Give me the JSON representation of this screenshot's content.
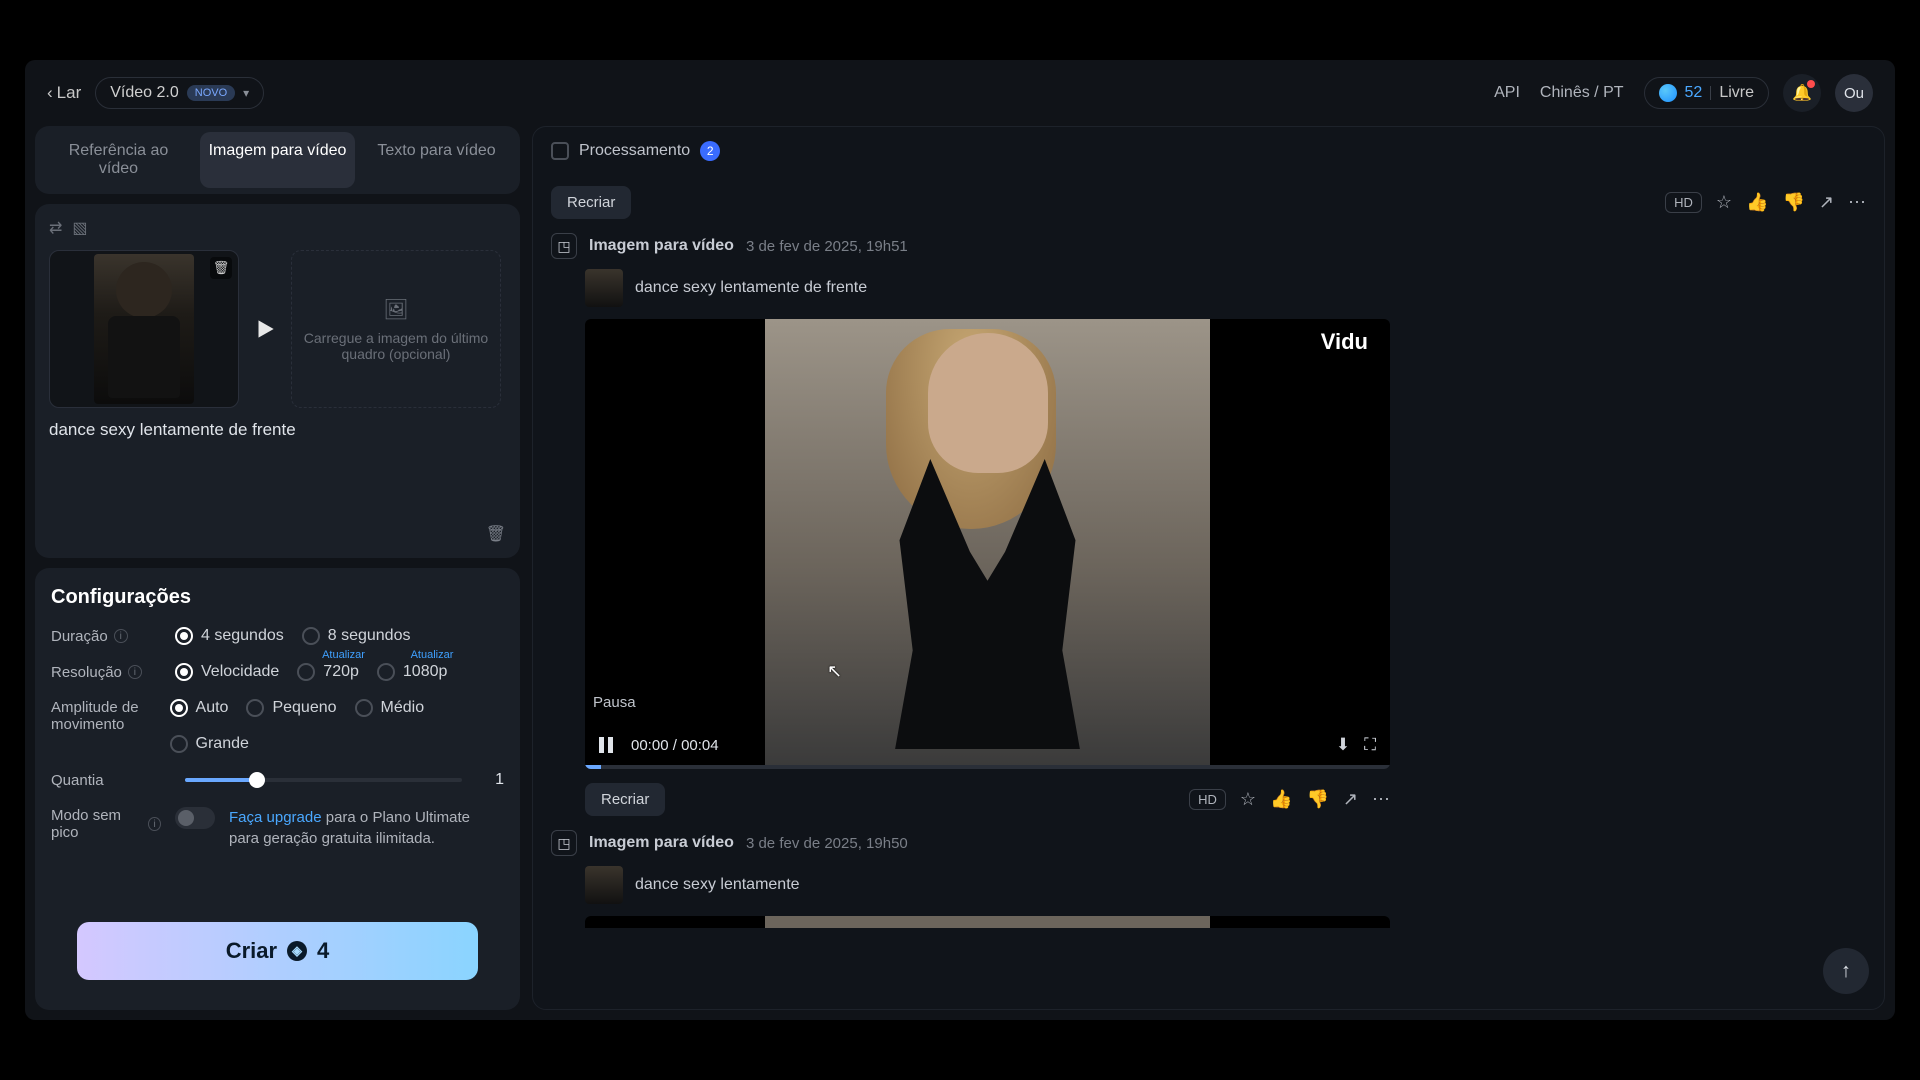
{
  "header": {
    "back_label": "Lar",
    "version_label": "Vídeo 2.0",
    "novo_badge": "NOVO",
    "api_label": "API",
    "language_label": "Chinês / PT",
    "credits": "52",
    "plan": "Livre",
    "avatar_initials": "Ou"
  },
  "tabs": {
    "ref": "Referência ao vídeo",
    "img": "Imagem para vídeo",
    "txt": "Texto para vídeo"
  },
  "upload": {
    "drop_text": "Carregue a imagem do último quadro (opcional)",
    "prompt": "dance sexy lentamente de frente"
  },
  "settings": {
    "title": "Configurações",
    "duration_label": "Duração",
    "duration_4s": "4 segundos",
    "duration_8s": "8 segundos",
    "resolution_label": "Resolução",
    "res_speed": "Velocidade",
    "res_720": "720p",
    "res_1080": "1080p",
    "atualizar": "Atualizar",
    "motion_label": "Amplitude de movimento",
    "motion_auto": "Auto",
    "motion_small": "Pequeno",
    "motion_medium": "Médio",
    "motion_large": "Grande",
    "quantity_label": "Quantia",
    "quantity_value": "1",
    "offpeak_label": "Modo sem pico",
    "upgrade_link": "Faça upgrade",
    "upgrade_rest": " para o Plano Ultimate para geração gratuita ilimitada."
  },
  "create": {
    "label": "Criar",
    "cost": "4"
  },
  "main": {
    "processing_label": "Processamento",
    "processing_count": "2",
    "recriar": "Recriar",
    "hd": "HD",
    "gen_type": "Imagem para vídeo",
    "gen1_time": "3 de fev de 2025, 19h51",
    "gen1_prompt": "dance sexy lentamente de frente",
    "gen2_time": "3 de fev de 2025, 19h50",
    "gen2_prompt": "dance sexy lentamente",
    "watermark": "Vidu",
    "pause_label": "Pausa",
    "time_current": "00:00",
    "time_sep": " / ",
    "time_total": "00:04"
  }
}
